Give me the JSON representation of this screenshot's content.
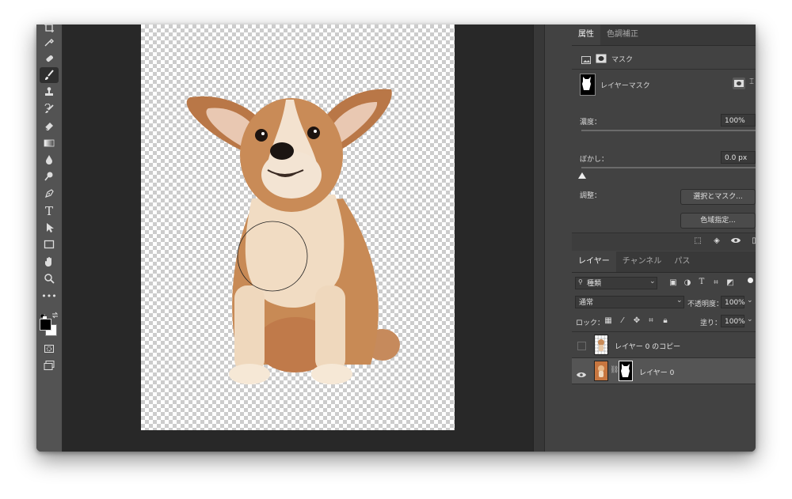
{
  "properties_panel": {
    "tabs": [
      {
        "label": "属性",
        "active": true
      },
      {
        "label": "色調補正",
        "active": false
      }
    ],
    "mask_header": "マスク",
    "layer_mask_label": "レイヤーマスク",
    "density_label": "濃度：",
    "density_value": "100%",
    "feather_label": "ぼかし：",
    "feather_value": "0.0 px",
    "refine_label": "調整：",
    "select_mask_button": "選択とマスク...",
    "color_range_button": "色域指定..."
  },
  "layers_panel": {
    "tabs": [
      {
        "label": "レイヤー",
        "active": true
      },
      {
        "label": "チャンネル",
        "active": false
      },
      {
        "label": "パス",
        "active": false
      }
    ],
    "filter_kind": "種類",
    "blend_mode": "通常",
    "opacity_label": "不透明度：",
    "opacity_value": "100%",
    "lock_label": "ロック：",
    "fill_label": "塗り：",
    "fill_value": "100%",
    "layers": [
      {
        "name": "レイヤー 0 のコピー",
        "visible": false,
        "selected": false
      },
      {
        "name": "レイヤー 0",
        "visible": true,
        "selected": true
      }
    ]
  },
  "toolbar": {
    "tools": [
      "crop-icon",
      "eyedropper-icon",
      "healing-brush-icon",
      "brush-icon",
      "stamp-icon",
      "history-brush-icon",
      "eraser-icon",
      "gradient-icon",
      "blur-icon",
      "dodge-icon",
      "pen-icon",
      "type-icon",
      "path-select-icon",
      "rectangle-icon",
      "hand-icon",
      "zoom-icon",
      "more-icon"
    ],
    "active_tool": "brush-icon",
    "foreground_color": "#000000",
    "background_color": "#ffffff",
    "type_tool_glyph": "T"
  },
  "colors": {
    "app_bg": "#323232",
    "panel_bg": "#424242",
    "canvas_dark": "#282828"
  }
}
